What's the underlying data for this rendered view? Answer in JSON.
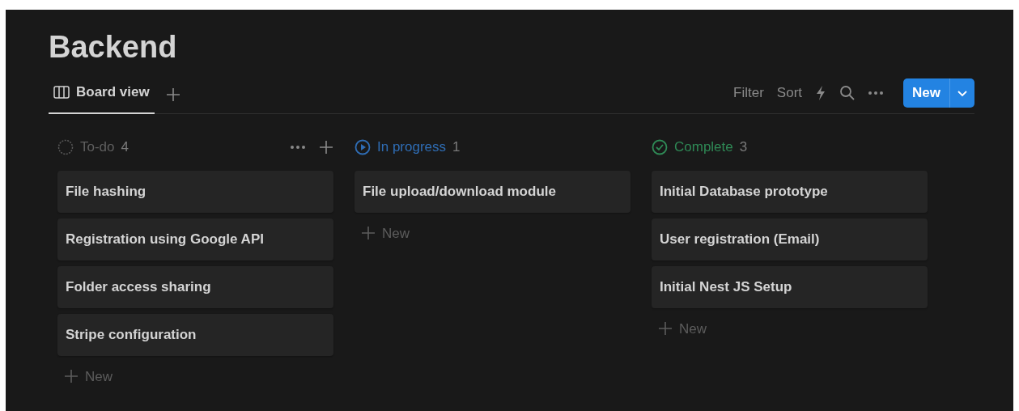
{
  "title": "Backend",
  "views": [
    {
      "label": "Board view",
      "selected": true
    }
  ],
  "toolbar": {
    "filter": "Filter",
    "sort": "Sort",
    "new_button": "New"
  },
  "groups": [
    {
      "kind": "todo",
      "name": "To-do",
      "count": "4",
      "color": "#5a5a5a",
      "cards": [
        "File hashing",
        "Registration using Google API",
        "Folder access sharing",
        "Stripe configuration"
      ],
      "add_label": "New",
      "show_actions": true
    },
    {
      "kind": "progress",
      "name": "In progress",
      "count": "1",
      "color": "#2f6db5",
      "cards": [
        "File upload/download module"
      ],
      "add_label": "New",
      "show_actions": false
    },
    {
      "kind": "complete",
      "name": "Complete",
      "count": "3",
      "color": "#2f8a56",
      "cards": [
        "Initial Database prototype",
        "User registration (Email)",
        "Initial Nest JS Setup"
      ],
      "add_label": "New",
      "show_actions": false
    }
  ]
}
